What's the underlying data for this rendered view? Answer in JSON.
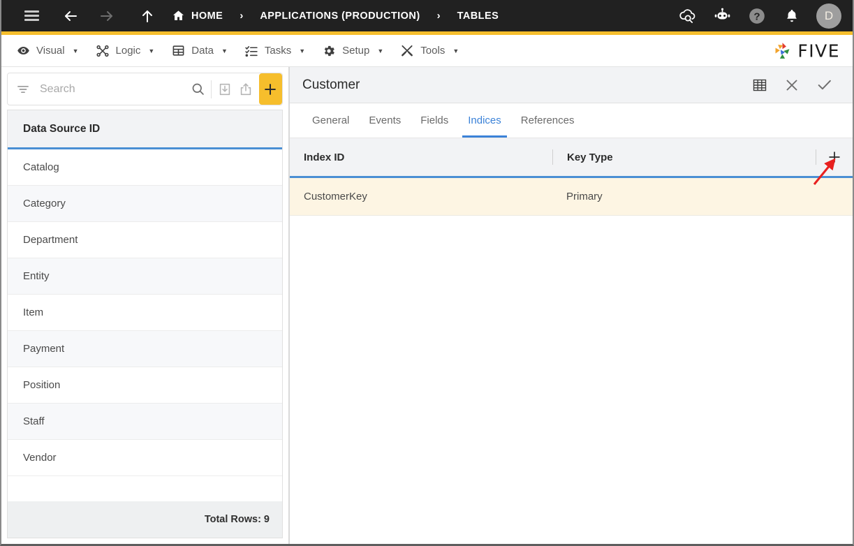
{
  "topbar": {
    "menu_icon": "hamburger-icon",
    "back_icon": "arrow-left-icon",
    "forward_icon": "arrow-right-icon",
    "up_icon": "arrow-up-icon",
    "home_icon": "home-icon",
    "breadcrumb": [
      {
        "label": "HOME",
        "icon": "home-icon"
      },
      {
        "label": "APPLICATIONS (PRODUCTION)"
      },
      {
        "label": "TABLES"
      }
    ],
    "separator": "›",
    "actions": [
      {
        "name": "cloud-search-icon",
        "title": "Cloud Search"
      },
      {
        "name": "robot-icon",
        "title": "Assistant"
      },
      {
        "name": "help-icon",
        "title": "Help"
      },
      {
        "name": "bell-icon",
        "title": "Notifications"
      }
    ],
    "avatar_initial": "D",
    "accent_bar_color": "#f6be2c",
    "background": "#212121"
  },
  "menubar": {
    "items": [
      {
        "label": "Visual",
        "icon": "eye-icon",
        "caret": "▼"
      },
      {
        "label": "Logic",
        "icon": "logic-flow-icon",
        "caret": "▼"
      },
      {
        "label": "Data",
        "icon": "table-grid-icon",
        "caret": "▼"
      },
      {
        "label": "Tasks",
        "icon": "checklist-icon",
        "caret": "▼"
      },
      {
        "label": "Setup",
        "icon": "gear-icon",
        "caret": "▼"
      },
      {
        "label": "Tools",
        "icon": "tools-icon",
        "caret": "▼"
      }
    ],
    "brand": {
      "text": "FIVE",
      "logo": "five-pinwheel-logo"
    }
  },
  "sidebar": {
    "search": {
      "placeholder": "Search",
      "value": "",
      "filter_icon": "filter-icon",
      "search_icon": "search-icon",
      "import_icon": "import-download-icon",
      "export_icon": "export-upload-icon",
      "add_icon": "plus-icon",
      "add_color": "#f6be2c"
    },
    "column_header": "Data Source ID",
    "items": [
      {
        "label": "Catalog"
      },
      {
        "label": "Category"
      },
      {
        "label": "Department"
      },
      {
        "label": "Entity"
      },
      {
        "label": "Item"
      },
      {
        "label": "Payment"
      },
      {
        "label": "Position"
      },
      {
        "label": "Staff"
      },
      {
        "label": "Vendor"
      }
    ],
    "footer": "Total Rows: 9"
  },
  "detail": {
    "title": "Customer",
    "header_actions": [
      {
        "name": "table-grid-icon",
        "title": "Grid View"
      },
      {
        "name": "close-icon",
        "title": "Cancel"
      },
      {
        "name": "check-icon",
        "title": "Save"
      }
    ],
    "tabs": [
      {
        "label": "General",
        "active": false
      },
      {
        "label": "Events",
        "active": false
      },
      {
        "label": "Fields",
        "active": false
      },
      {
        "label": "Indices",
        "active": true
      },
      {
        "label": "References",
        "active": false
      }
    ],
    "grid": {
      "columns": [
        "Index ID",
        "Key Type"
      ],
      "add_icon": "plus-icon",
      "rows": [
        {
          "index_id": "CustomerKey",
          "key_type": "Primary",
          "highlighted": true
        }
      ],
      "row_highlight_color": "#fdf5e3",
      "header_underline_color": "#4a8fd4"
    }
  },
  "annotation": {
    "arrow": {
      "color": "#e8201f",
      "points_to": "grid-add-index-button"
    }
  }
}
